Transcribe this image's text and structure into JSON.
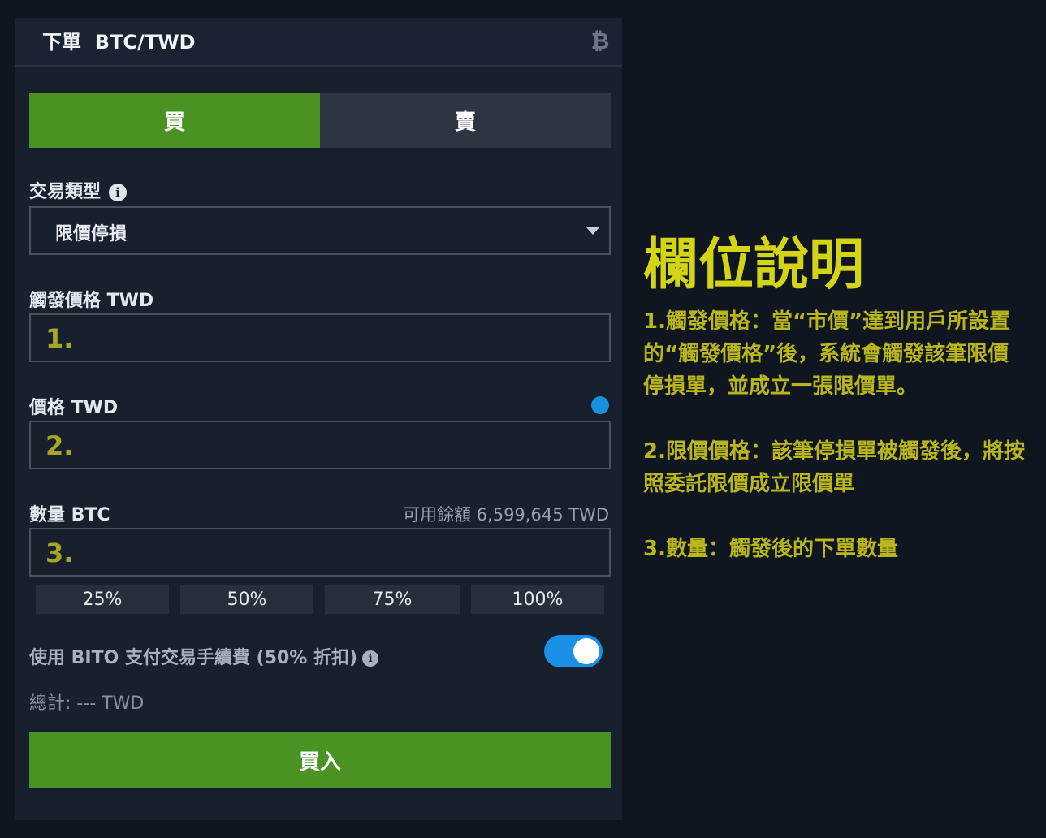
{
  "header": {
    "title": "下單  BTC/TWD",
    "icon": "bitcoin-icon"
  },
  "side_tabs": {
    "buy": "買",
    "sell": "賣",
    "active": "buy"
  },
  "order_type": {
    "label": "交易類型",
    "value": "限價停損"
  },
  "trigger_price": {
    "label": "觸發價格 TWD",
    "annotation": "1."
  },
  "price": {
    "label": "價格 TWD",
    "annotation": "2."
  },
  "quantity": {
    "label": "數量 BTC",
    "available": "可用餘額 6,599,645 TWD",
    "annotation": "3."
  },
  "percent_buttons": [
    "25%",
    "50%",
    "75%",
    "100%"
  ],
  "fee": {
    "label": "使用 BITO 支付交易手續費 (50% 折扣)",
    "toggle_on": true
  },
  "total": "總計: --- TWD",
  "submit_label": "買入",
  "explanation": {
    "title": "欄位說明",
    "items": [
      "1.觸發價格：當“市價”達到用戶所設置的“觸發價格”後，系統會觸發該筆限價停損單，並成立一張限價單。",
      "2.限價價格：該筆停損單被觸發後，將按照委託限價成立限價單",
      "3.數量：觸發後的下單數量"
    ]
  },
  "colors": {
    "buy_green": "#4a9322",
    "annotation_yellow": "#d4d416",
    "toggle_blue": "#1a8fe6"
  }
}
